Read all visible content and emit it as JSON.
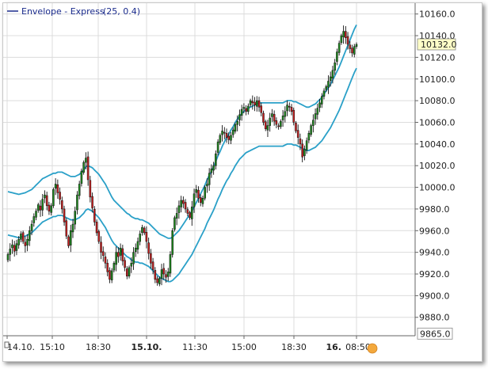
{
  "legend": {
    "label": "Envelope - Express",
    "params": "(25, 0.4)"
  },
  "last_price": "10132.0",
  "min_marker": "9865.0",
  "colors": {
    "up": "#1e8a1e",
    "down": "#c81e1e",
    "envelope": "#2aa0c8",
    "grid": "#dcdcdc",
    "label_bg": "#ffffc8"
  },
  "chart_data": {
    "type": "candlestick",
    "title": "",
    "ylim": [
      9865,
      10160
    ],
    "y_ticks": [
      "10160.0",
      "10140.0",
      "10120.0",
      "10100.0",
      "10080.0",
      "10060.0",
      "10040.0",
      "10020.0",
      "10000.0",
      "9980.0",
      "9960.0",
      "9940.0",
      "9920.0",
      "9900.0",
      "9880.0"
    ],
    "x_ticks": [
      {
        "label": "14.10.",
        "bold": false
      },
      {
        "label": "15:10",
        "bold": false
      },
      {
        "label": "18:30",
        "bold": false
      },
      {
        "label": "15.10.",
        "bold": true
      },
      {
        "label": "11:30",
        "bold": false
      },
      {
        "label": "15:00",
        "bold": false
      },
      {
        "label": "18:30",
        "bold": false
      },
      {
        "label": "16.",
        "bold": true
      },
      {
        "label": "08:50",
        "bold": false
      }
    ],
    "close": [
      9938,
      9943,
      9947,
      9941,
      9948,
      9952,
      9957,
      9950,
      9946,
      9952,
      9960,
      9966,
      9973,
      9978,
      9984,
      9979,
      9989,
      9993,
      9983,
      9978,
      9983,
      9998,
      10003,
      9995,
      9989,
      9980,
      9968,
      9955,
      9946,
      9960,
      9966,
      9978,
      9993,
      10003,
      10015,
      10023,
      10027,
      10007,
      9991,
      9981,
      9968,
      9958,
      9950,
      9940,
      9937,
      9930,
      9922,
      9915,
      9923,
      9930,
      9940,
      9936,
      9944,
      9932,
      9926,
      9918,
      9926,
      9930,
      9940,
      9944,
      9950,
      9957,
      9963,
      9958,
      9950,
      9939,
      9930,
      9924,
      9915,
      9912,
      9916,
      9924,
      9920,
      9917,
      9922,
      9938,
      9960,
      9972,
      9976,
      9983,
      9988,
      9985,
      9980,
      9976,
      9972,
      9982,
      9994,
      9998,
      9990,
      9986,
      9990,
      10000,
      10003,
      10013,
      10017,
      10020,
      10031,
      10042,
      10048,
      10052,
      10050,
      10046,
      10044,
      10048,
      10053,
      10058,
      10061,
      10067,
      10072,
      10074,
      10070,
      10075,
      10080,
      10078,
      10076,
      10080,
      10074,
      10069,
      10060,
      10054,
      10057,
      10064,
      10068,
      10061,
      10058,
      10056,
      10061,
      10066,
      10070,
      10076,
      10074,
      10070,
      10060,
      10052,
      10046,
      10040,
      10028,
      10035,
      10043,
      10050,
      10057,
      10062,
      10068,
      10073,
      10078,
      10084,
      10089,
      10093,
      10098,
      10102,
      10108,
      10115,
      10125,
      10133,
      10140,
      10144,
      10138,
      10132,
      10128,
      10124,
      10130,
      10132
    ],
    "ma": [
      9976,
      9975.5,
      9975,
      9974.5,
      9974,
      9973.5,
      9974,
      9974.5,
      9975,
      9976,
      9977,
      9978,
      9980,
      9982,
      9984,
      9986,
      9988,
      9989,
      9990,
      9991,
      9992,
      9993,
      9993,
      9994,
      9994,
      9994,
      9993,
      9992,
      9991,
      9990,
      9990,
      9990,
      9991,
      9992,
      9994,
      9996,
      9999,
      10000,
      9999,
      9998,
      9996,
      9994,
      9992,
      9989,
      9986,
      9983,
      9979,
      9975,
      9971,
      9968,
      9966,
      9964,
      9962,
      9960,
      9958,
      9956,
      9955,
      9953,
      9952,
      9951,
      9951,
      9950,
      9950,
      9949,
      9948,
      9947,
      9945,
      9943,
      9941,
      9939,
      9937,
      9936,
      9935,
      9934,
      9933,
      9933,
      9934,
      9936,
      9938,
      9940,
      9943,
      9946,
      9949,
      9952,
      9955,
      9958,
      9962,
      9966,
      9970,
      9974,
      9978,
      9982,
      9987,
      9991,
      9995,
      9999,
      10004,
      10009,
      10013,
      10018,
      10022,
      10026,
      10029,
      10033,
      10036,
      10040,
      10043,
      10046,
      10048,
      10050,
      10052,
      10053,
      10054,
      10055,
      10056,
      10057,
      10058,
      10058,
      10058,
      10058,
      10058,
      10058,
      10058,
      10058,
      10058,
      10058,
      10058,
      10058,
      10059,
      10060,
      10060,
      10060,
      10059,
      10059,
      10058,
      10057,
      10056,
      10055,
      10054,
      10054,
      10055,
      10056,
      10057,
      10059,
      10061,
      10063,
      10066,
      10069,
      10072,
      10075,
      10079,
      10083,
      10087,
      10091,
      10096,
      10101,
      10106,
      10111,
      10116,
      10121,
      10126,
      10130
    ]
  }
}
